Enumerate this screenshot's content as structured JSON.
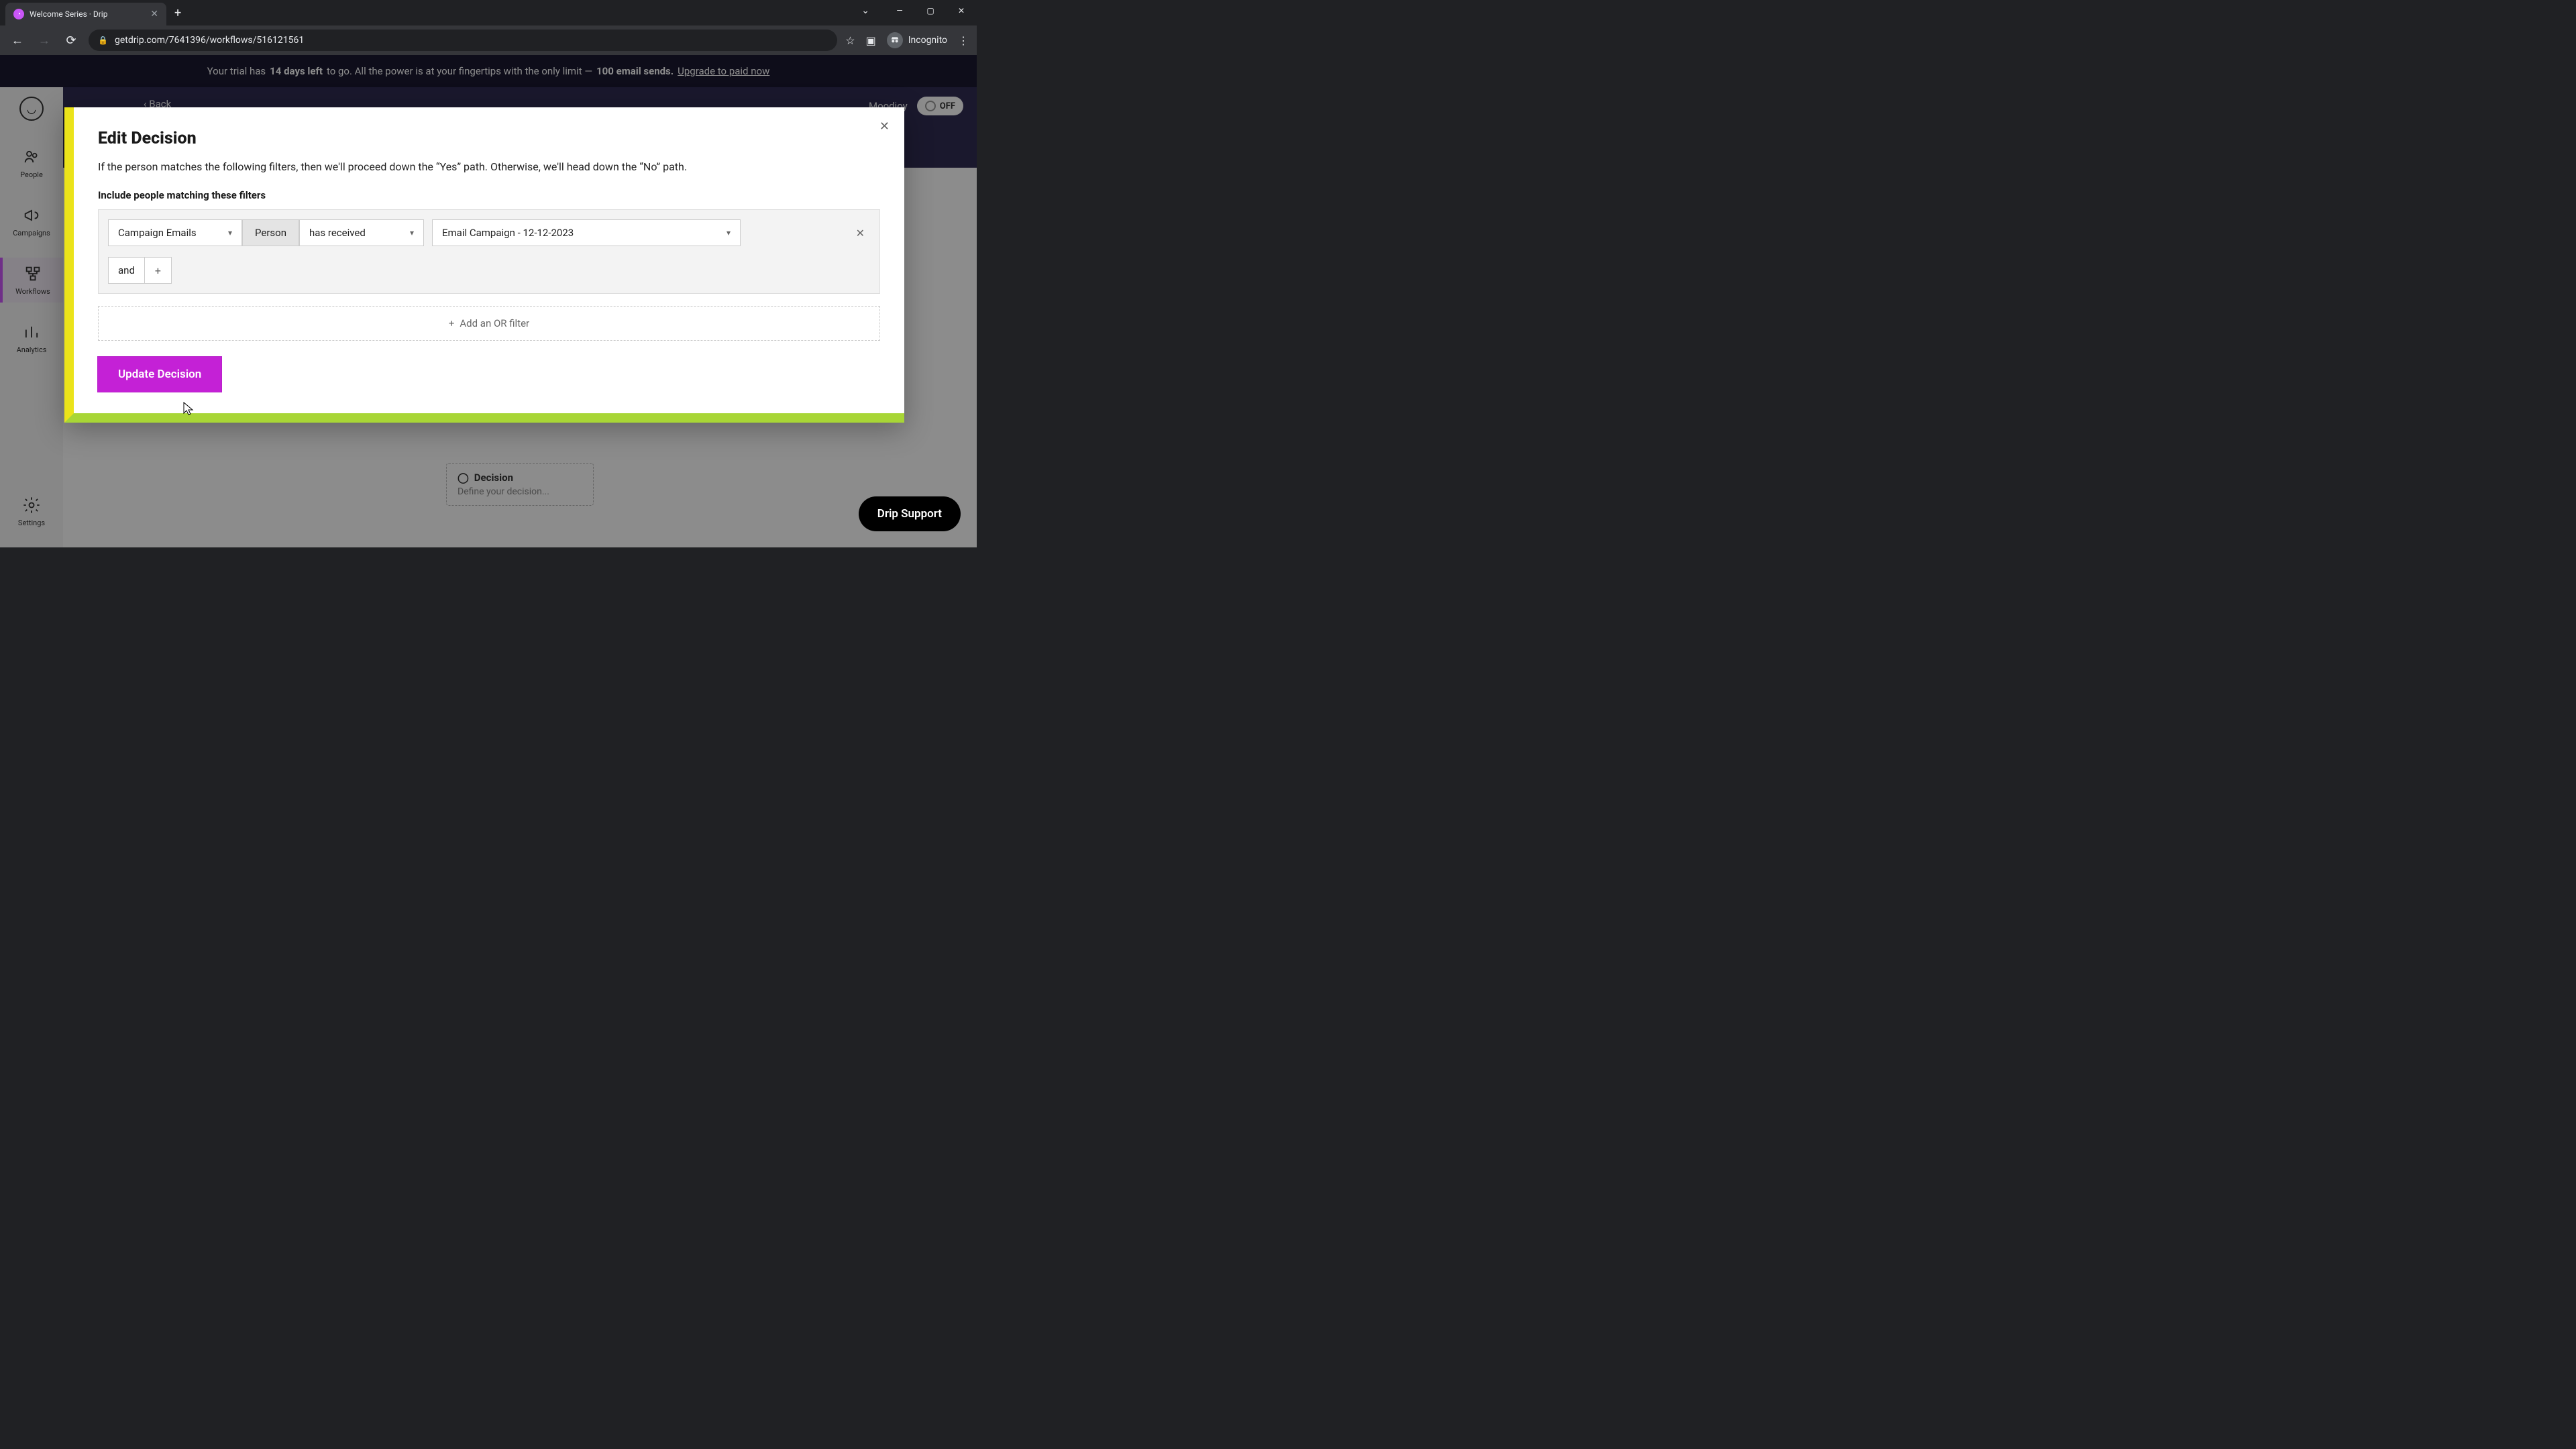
{
  "browser": {
    "tab_title": "Welcome Series · Drip",
    "url": "getdrip.com/7641396/workflows/516121561",
    "profile": "Incognito"
  },
  "trial": {
    "prefix": "Your trial has ",
    "days": "14 days left",
    "middle": " to go. All the power is at your fingertips with the only limit — ",
    "sends": "100 email sends.",
    "cta": " Upgrade to paid now"
  },
  "sidebar": {
    "items": [
      {
        "label": "People"
      },
      {
        "label": "Campaigns"
      },
      {
        "label": "Workflows"
      },
      {
        "label": "Analytics"
      }
    ],
    "settings": "Settings"
  },
  "topbar": {
    "back": "Back",
    "account": "Moodjoy",
    "toggle": "OFF"
  },
  "node": {
    "title": "Decision",
    "subtitle": "Define your decision..."
  },
  "modal": {
    "title": "Edit Decision",
    "description": "If the person matches the following filters, then we'll proceed down the “Yes” path. Otherwise, we'll head down the “No” path.",
    "filter_heading": "Include people matching these filters",
    "filter": {
      "category": "Campaign Emails",
      "subject": "Person",
      "condition": "has received",
      "value": "Email Campaign - 12-12-2023"
    },
    "and_label": "and",
    "add_or": "Add an OR filter",
    "submit": "Update Decision"
  },
  "support": "Drip Support"
}
